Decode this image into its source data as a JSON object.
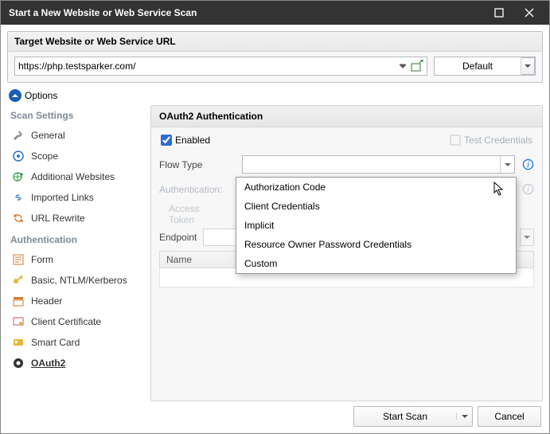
{
  "window": {
    "title": "Start a New Website or Web Service Scan"
  },
  "target": {
    "heading": "Target Website or Web Service URL",
    "url": "https://php.testsparker.com/",
    "profile": "Default"
  },
  "options": {
    "label": "Options"
  },
  "sidebar": {
    "sections": [
      {
        "title": "Scan Settings",
        "items": [
          {
            "label": "General",
            "icon": "wrench-icon"
          },
          {
            "label": "Scope",
            "icon": "target-icon"
          },
          {
            "label": "Additional Websites",
            "icon": "globe-plus-icon"
          },
          {
            "label": "Imported Links",
            "icon": "link-icon"
          },
          {
            "label": "URL Rewrite",
            "icon": "rewrite-icon"
          }
        ]
      },
      {
        "title": "Authentication",
        "items": [
          {
            "label": "Form",
            "icon": "form-icon"
          },
          {
            "label": "Basic, NTLM/Kerberos",
            "icon": "key-icon"
          },
          {
            "label": "Header",
            "icon": "header-icon"
          },
          {
            "label": "Client Certificate",
            "icon": "certificate-icon"
          },
          {
            "label": "Smart Card",
            "icon": "card-icon"
          },
          {
            "label": "OAuth2",
            "icon": "oauth-icon",
            "active": true
          }
        ]
      }
    ]
  },
  "oauth": {
    "heading": "OAuth2 Authentication",
    "enabled_label": "Enabled",
    "enabled": true,
    "test_label": "Test Credentials",
    "rows": {
      "flow_type": "Flow Type",
      "authentication": "Authentication:",
      "access_token": "Access Token",
      "endpoint": "Endpoint"
    },
    "flow_options": [
      "Authorization Code",
      "Client Credentials",
      "Implicit",
      "Resource Owner Password Credentials",
      "Custom"
    ],
    "table_cols": {
      "name": "Name",
      "value": ""
    }
  },
  "footer": {
    "start": "Start Scan",
    "cancel": "Cancel"
  }
}
